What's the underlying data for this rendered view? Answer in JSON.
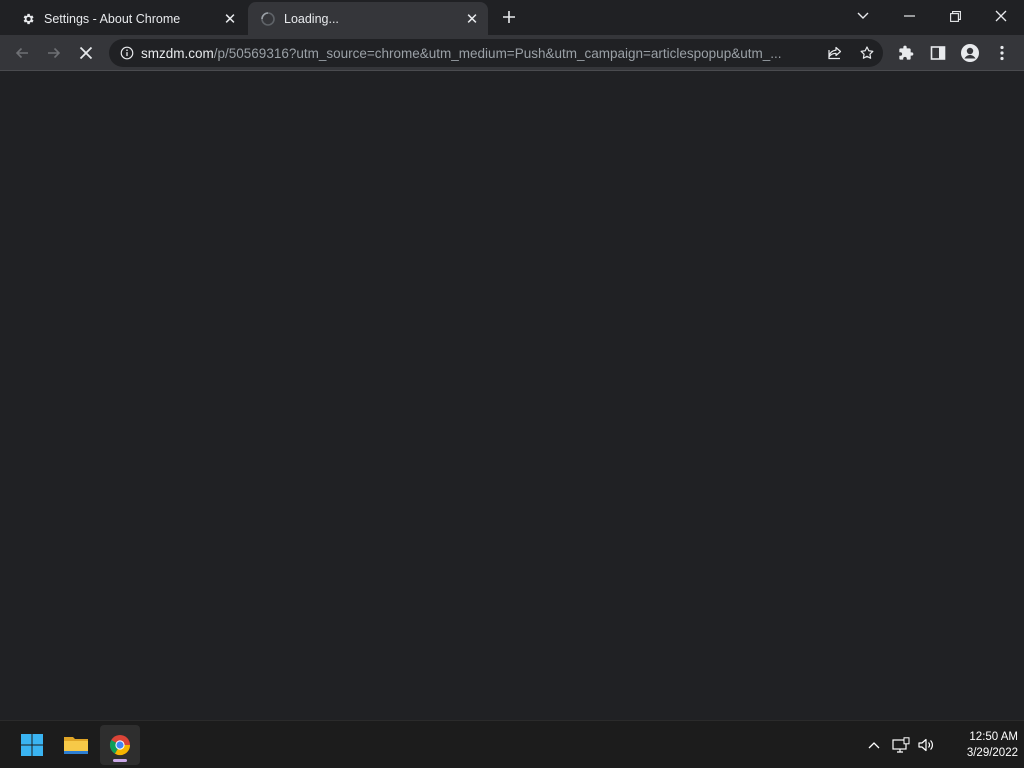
{
  "tabs": [
    {
      "title": "Settings - About Chrome",
      "icon": "gear-icon",
      "active": false
    },
    {
      "title": "Loading...",
      "icon": "loading-spinner-icon",
      "active": true
    }
  ],
  "toolbar": {
    "url_host": "smzdm.com",
    "url_rest": "/p/50569316?utm_source=chrome&utm_medium=Push&utm_campaign=articlespopup&utm_..."
  },
  "taskbar": {
    "apps": [
      "windows-start-icon",
      "file-explorer-icon",
      "chrome-icon"
    ],
    "time": "12:50 AM",
    "date": "3/29/2022"
  },
  "colors": {
    "background": "#202124",
    "toolbar": "#35363a",
    "taskbar": "#1c1c1c",
    "accent": "#8ab4f8"
  }
}
